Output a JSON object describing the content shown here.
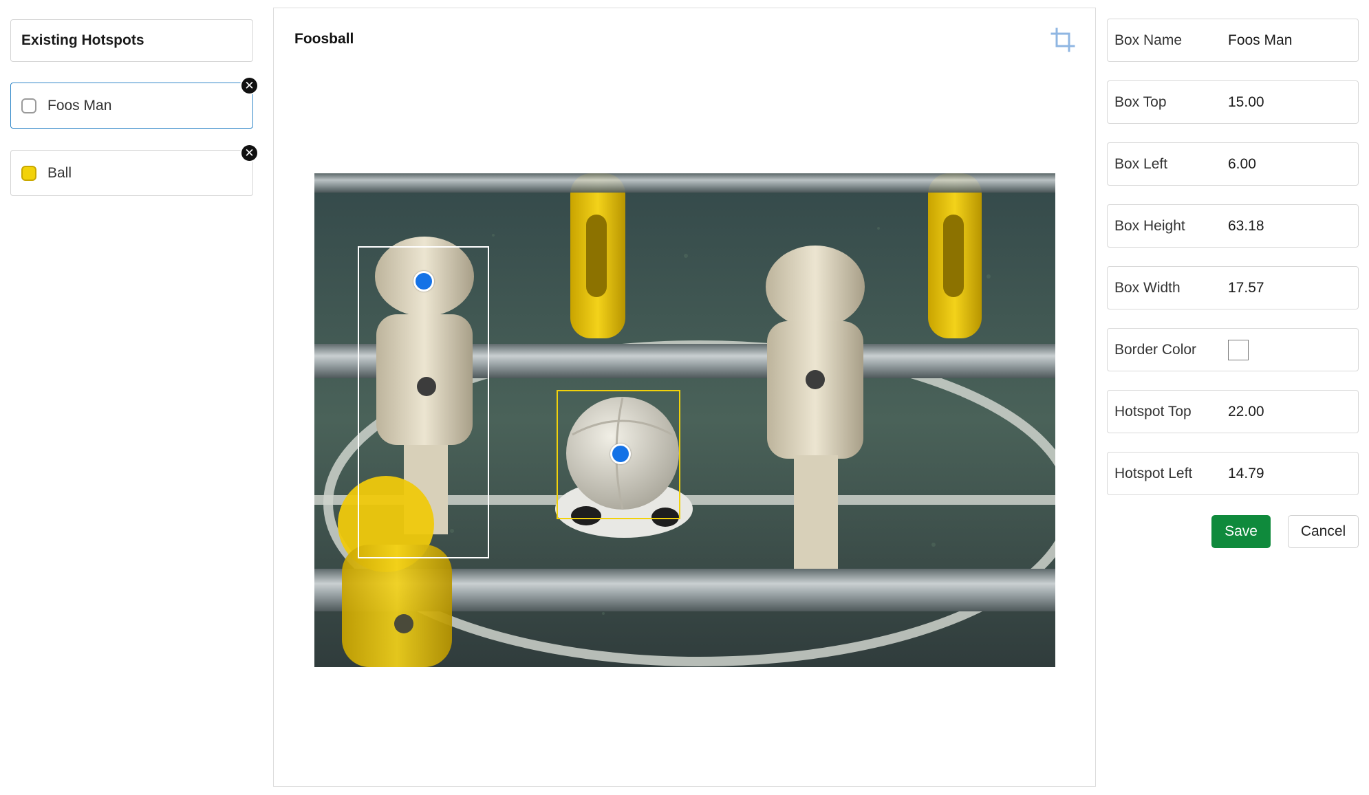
{
  "left": {
    "title": "Existing Hotspots",
    "hotspots": [
      {
        "label": "Foos Man",
        "swatch_color": "#ffffff",
        "selected": true
      },
      {
        "label": "Ball",
        "swatch_color": "#f2d20a",
        "selected": false
      }
    ],
    "remove_glyph": "✕"
  },
  "center": {
    "title": "Foosball",
    "crop_icon": "crop-icon"
  },
  "form": {
    "fields": [
      {
        "label": "Box Name",
        "value": "Foos Man"
      },
      {
        "label": "Box Top",
        "value": "15.00"
      },
      {
        "label": "Box Left",
        "value": "6.00"
      },
      {
        "label": "Box Height",
        "value": "63.18"
      },
      {
        "label": "Box Width",
        "value": "17.57"
      },
      {
        "label": "Border Color",
        "value": "#ffffff"
      },
      {
        "label": "Hotspot Top",
        "value": "22.00"
      },
      {
        "label": "Hotspot Left",
        "value": "14.79"
      }
    ],
    "save_label": "Save",
    "cancel_label": "Cancel"
  },
  "colors": {
    "selected_border": "#2f86c8",
    "save_green": "#0f8a3c",
    "hotspot_dot": "#1472e6",
    "ball_box": "#f2d20a",
    "foosman_box": "#ffffff"
  }
}
